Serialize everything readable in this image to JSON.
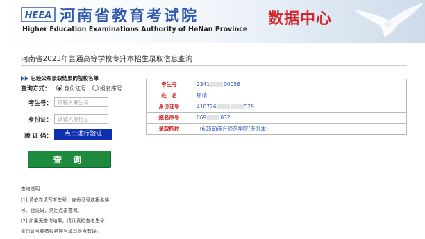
{
  "header": {
    "logo_text": "HEEA",
    "title_cn": "河南省教育考试院",
    "title_en": "Higher Education Examinations Authority of HeNan Province",
    "center_name": "数据中心"
  },
  "page_title": "河南省2023年普通高等学校专升本招生录取信息查询",
  "form": {
    "school_list_arrows": "▶▶",
    "school_list_link": "已经公布录取结果的院校名单",
    "mode_label": "查询方式：",
    "mode_options": [
      "身份证号",
      "报名序号"
    ],
    "mode_selected": "身份证号",
    "exam_no_label": "考生号：",
    "exam_no_placeholder": "请输入考生号",
    "id_label": "身份证：",
    "id_placeholder": "请输入身份证",
    "captcha_label": "验 证 码：",
    "verify_button": "点击进行验证",
    "query_button": "查 询"
  },
  "notes": {
    "heading": "查询说明:",
    "lines": [
      "[1] 请依次填写考生号、身份证号或报名序",
      "号、验证码，然后点击查询。",
      "[2] 如果无查询结果，请认真检查考生号、",
      "身份证号或者报名序号填写是否有误。"
    ]
  },
  "result": {
    "rows": [
      {
        "key": "考生号",
        "pre": "2341",
        "post": "00056"
      },
      {
        "key": "姓　名",
        "pre": "邢靖",
        "post": ""
      },
      {
        "key": "身份证号",
        "pre": "410726",
        "post": "529"
      },
      {
        "key": "报名序号",
        "pre": "069",
        "post": "032"
      },
      {
        "key": "录取院校",
        "pre": "（6056)商丘师范学院(专升本)",
        "post": ""
      }
    ]
  },
  "colors": {
    "brand_blue": "#2f58b0",
    "center_red": "#d5252b",
    "verify_blue": "#0f2fb3",
    "query_green": "#1d8a3e",
    "key_red": "#cc1f1f",
    "value_blue": "#2a53b3"
  },
  "icons": {
    "logo": "heea-logo-icon",
    "bird": "eagle-icon",
    "radio": "radio-icon"
  }
}
